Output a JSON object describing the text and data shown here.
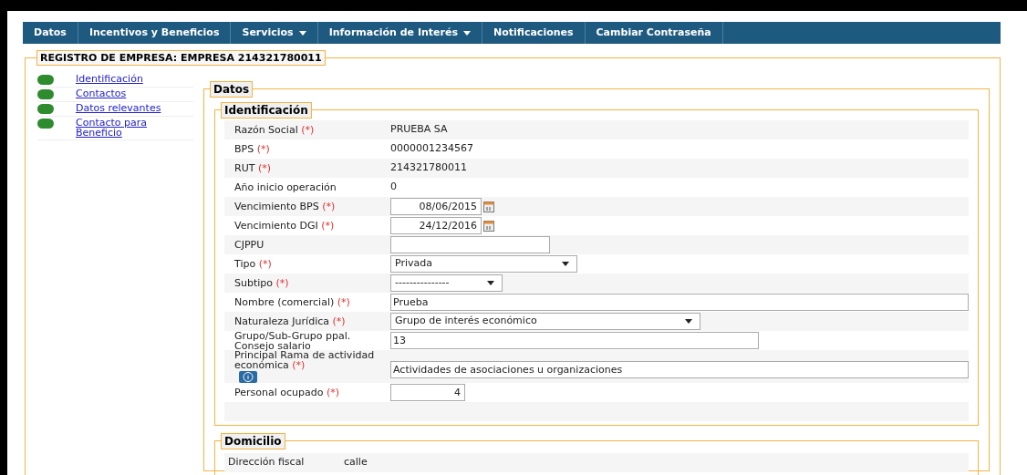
{
  "nav": [
    {
      "label": "Datos",
      "caret": false
    },
    {
      "label": "Incentivos y Beneficios",
      "caret": false
    },
    {
      "label": "Servicios",
      "caret": true
    },
    {
      "label": "Información de Interés",
      "caret": true
    },
    {
      "label": "Notificaciones",
      "caret": false
    },
    {
      "label": "Cambiar Contraseña",
      "caret": false
    }
  ],
  "title": "REGISTRO DE EMPRESA: EMPRESA 214321780011",
  "sidebar": {
    "items": [
      {
        "label": "Identificación",
        "color": "#2e8b2e"
      },
      {
        "label": "Contactos",
        "color": "#2e8b2e"
      },
      {
        "label": "Datos relevantes",
        "color": "#2e8b2e"
      },
      {
        "label": "Contacto para Beneficio",
        "color": "#2e8b2e"
      }
    ]
  },
  "datos": {
    "legend": "Datos",
    "identificacion": {
      "legend": "Identificación",
      "rows": [
        {
          "kind": "text",
          "label": "Razón Social",
          "mark": "(*)",
          "value": "PRUEBA SA"
        },
        {
          "kind": "text",
          "label": "BPS",
          "mark": "(*)",
          "value": "0000001234567"
        },
        {
          "kind": "text",
          "label": "RUT",
          "mark": "(*)",
          "value": "214321780011"
        },
        {
          "kind": "text",
          "label": "Año inicio operación",
          "value": "0"
        },
        {
          "kind": "date",
          "label": "Vencimiento BPS",
          "mark": "(*)",
          "value": "08/06/2015"
        },
        {
          "kind": "date",
          "label": "Vencimiento DGI",
          "mark": "(*)",
          "value": "24/12/2016"
        },
        {
          "kind": "input",
          "label": "CJPPU"
        },
        {
          "kind": "select",
          "label": "Tipo",
          "mark": "(*)",
          "value": "Privada"
        },
        {
          "kind": "select",
          "label": "Subtipo",
          "mark": "(*)",
          "value": "---------------"
        },
        {
          "kind": "input",
          "label": "Nombre (comercial)",
          "mark": "(*)",
          "value": "Prueba"
        },
        {
          "kind": "select",
          "label": "Naturaleza Jurídica",
          "mark": "(*)",
          "value": "Grupo de interés económico"
        },
        {
          "kind": "input",
          "label": "Grupo/Sub-Grupo ppal. Consejo salario",
          "value": "13"
        },
        {
          "kind": "input",
          "label": "Principal Rama de actividad económica",
          "mark": "(*)",
          "value": "Actividades de asociaciones u organizaciones",
          "info": true
        },
        {
          "kind": "number",
          "label": "Personal ocupado",
          "mark": "(*)",
          "value": "4"
        }
      ]
    },
    "domicilio": {
      "legend": "Domicilio",
      "rows": [
        {
          "label": "Dirección fiscal",
          "value": "calle"
        }
      ]
    }
  }
}
